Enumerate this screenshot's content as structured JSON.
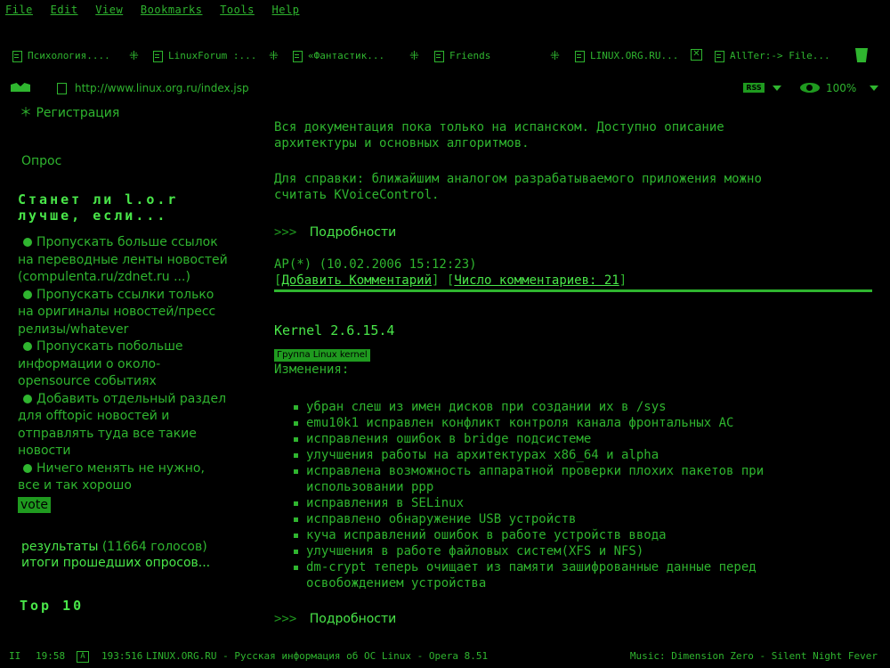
{
  "menu": [
    "File",
    "Edit",
    "View",
    "Bookmarks",
    "Tools",
    "Help"
  ],
  "tabs": [
    {
      "label": "Психология...."
    },
    {
      "label": "LinuxForum :..."
    },
    {
      "label": "«Фантастик..."
    },
    {
      "label": "Friends"
    },
    {
      "label": "LINUX.ORG.RU..."
    },
    {
      "label": "AllTer:-> File..."
    }
  ],
  "address": {
    "url": "http://www.linux.org.ru/index.jsp",
    "rss": "RSS",
    "zoom": "100%"
  },
  "sidebar": {
    "register": "Регистрация",
    "poll_title": "Опрос",
    "question_line1": "Станет ли l.o.r",
    "question_line2": "лучше, если...",
    "options": [
      [
        "Пропускать больше ссылок",
        "на переводные ленты новостей",
        "(compulenta.ru/zdnet.ru ...)"
      ],
      [
        "Пропускать ссылки только",
        "на оригиналы новостей/пресс",
        "релизы/whatever"
      ],
      [
        "Пропускать побольше",
        "информации о около-",
        "opensource событиях"
      ],
      [
        "Добавить отдельный раздел",
        "для offtopic новостей и",
        "отправлять туда все такие",
        "новости"
      ],
      [
        "Ничего менять не нужно,",
        "все и так хорошо"
      ]
    ],
    "vote": "vote",
    "results_link": "результаты",
    "results_count": "(11664 голосов)",
    "past_polls": "итоги прошедших опросов...",
    "top": "Top 10"
  },
  "content": {
    "para1_l1": "Вся документация пока только на испанском. Доступно описание",
    "para1_l2": "архитектуры и основных алгоритмов.",
    "para2_l1": "Для справки: ближайшим аналогом разрабатываемого приложения можно",
    "para2_l2": "считать KVoiceControl.",
    "more1": "Подробности",
    "author_line": "AP(*) (10.02.2006 15:12:23)",
    "add_comment": "Добавить Комментарий",
    "comment_count": "Число комментариев: 21",
    "headline": "Kernel 2.6.15.4",
    "group": "Группа Linux kernel",
    "changes_label": "Изменения:",
    "changes": [
      [
        "убран слеш из имен дисков при создании их в /sys"
      ],
      [
        "emu10k1 исправлен конфликт контроля канала фронтальных AC"
      ],
      [
        "исправления ошибок в bridge подсистеме"
      ],
      [
        "улучшения работы на архитектурах x86_64 и alpha"
      ],
      [
        "исправлена возможность аппаратной проверки плохих пакетов при",
        "использовании ppp"
      ],
      [
        "исправления в SELinux"
      ],
      [
        "исправлено обнаружение USB устройств"
      ],
      [
        "куча исправлений ошибок в работе устройств ввода"
      ],
      [
        "улучшения в работе файловых систем(XFS и NFS)"
      ],
      [
        "dm-crypt теперь очищает из памяти зашифрованные данные перед",
        "освобождением устройства"
      ]
    ],
    "more2": "Подробности",
    "arrows": ">>>"
  },
  "status": {
    "pause": "II",
    "time": "19:58",
    "a": "A",
    "count": "193:516",
    "title": "LINUX.ORG.RU - Русская информация об ОС Linux - Opera 8.51",
    "music": "Music: Dimension Zero - Silent Night Fever"
  }
}
